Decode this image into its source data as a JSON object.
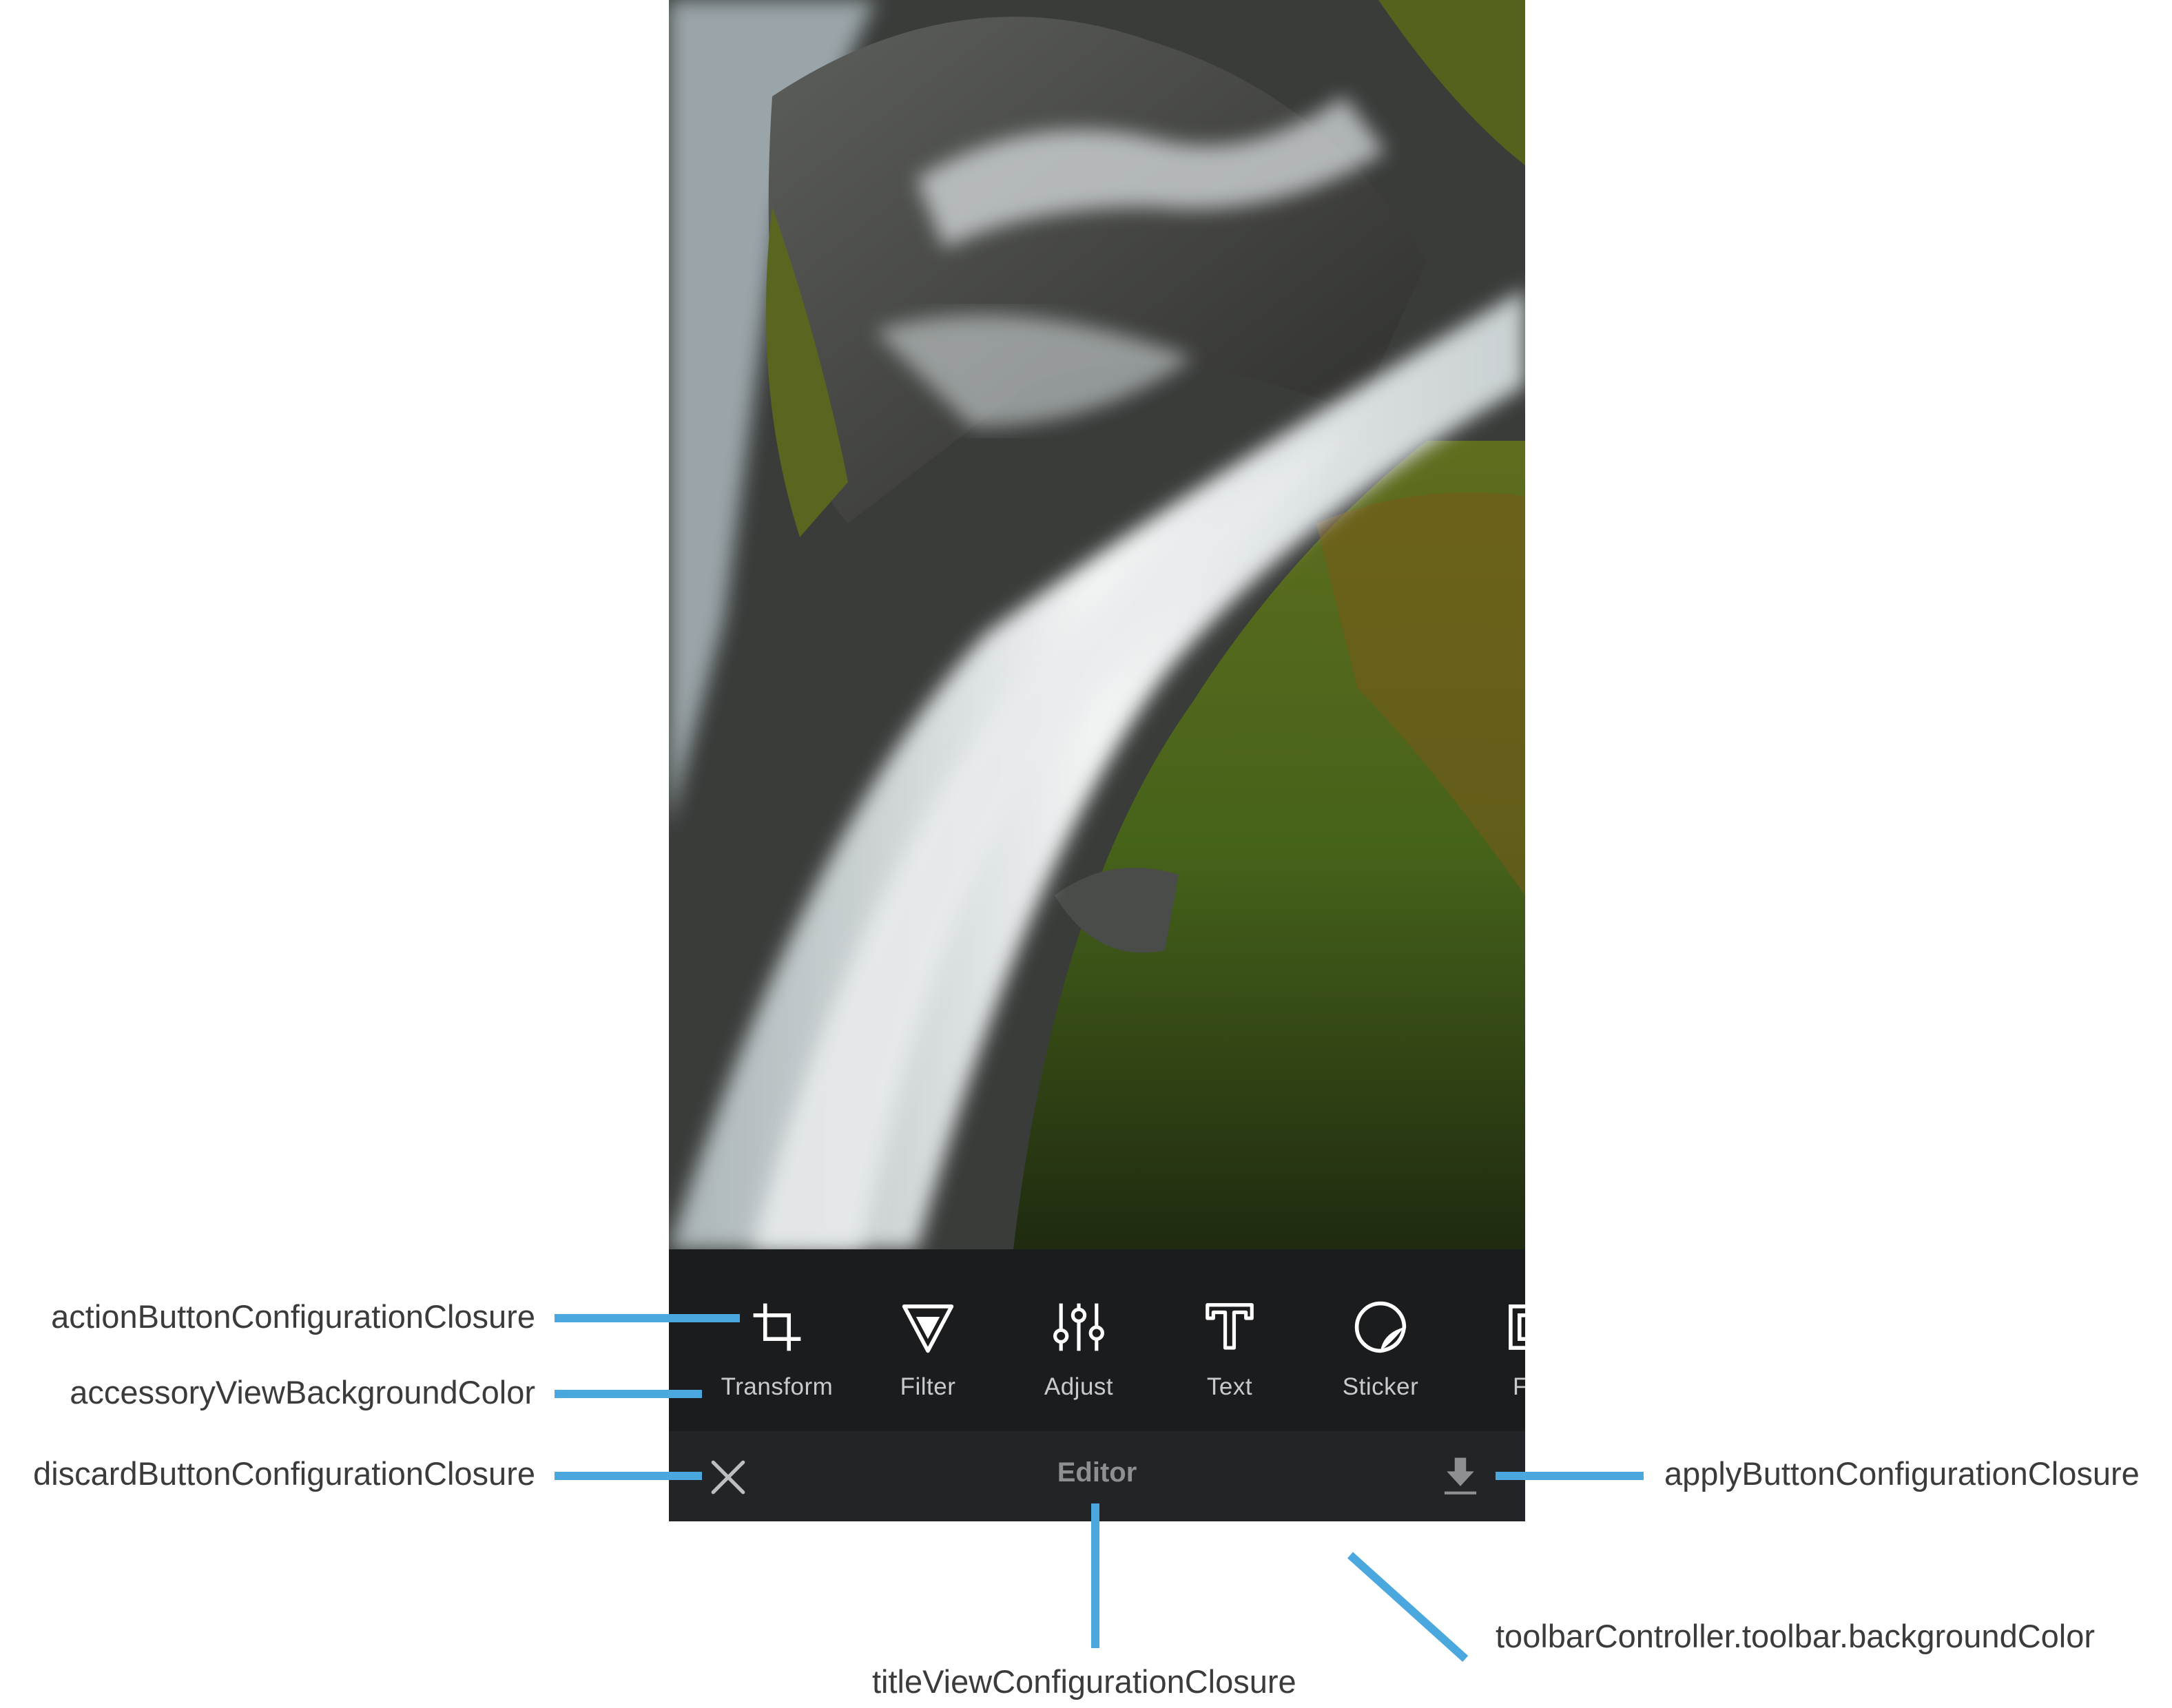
{
  "editor": {
    "title": "Editor",
    "discard_icon": "close-icon",
    "apply_icon": "download-icon",
    "tools": [
      {
        "label": "Transform",
        "icon": "crop-icon"
      },
      {
        "label": "Filter",
        "icon": "filter-icon"
      },
      {
        "label": "Adjust",
        "icon": "sliders-icon"
      },
      {
        "label": "Text",
        "icon": "text-icon"
      },
      {
        "label": "Sticker",
        "icon": "sticker-icon"
      },
      {
        "label": "Fra",
        "icon": "frame-icon"
      }
    ]
  },
  "annotations": {
    "action_button": "actionButtonConfigurationClosure",
    "accessory_bg": "accessoryViewBackgroundColor",
    "discard_button": "discardButtonConfigurationClosure",
    "apply_button": "applyButtonConfigurationClosure",
    "toolbar_bg": "toolbarController.toolbar.backgroundColor",
    "title_view": "titleViewConfigurationClosure"
  },
  "colors": {
    "annotation_line": "#4ba8de",
    "accessory_background": "#1b1c1e",
    "toolbar_background": "#232427",
    "tool_label": "#c9cacd",
    "title_text": "#8e8f92"
  }
}
